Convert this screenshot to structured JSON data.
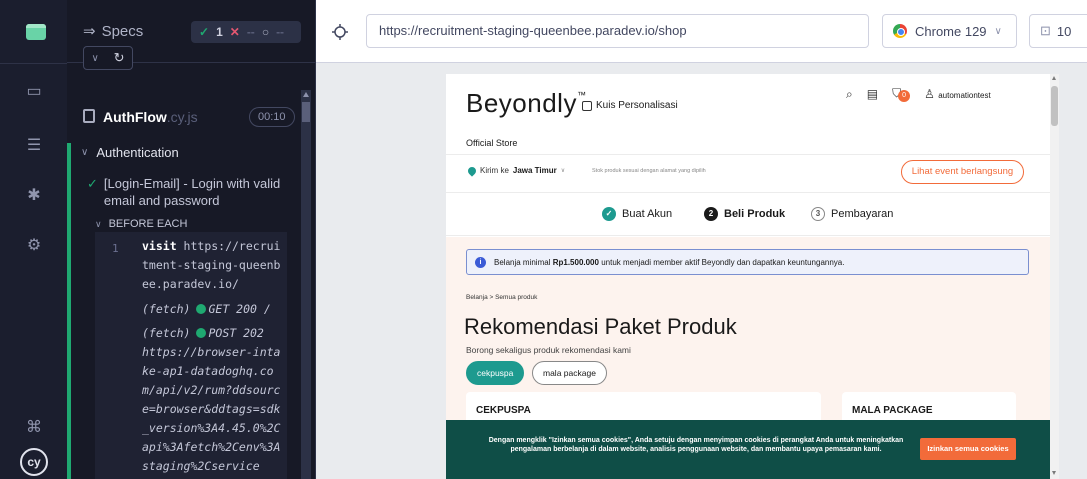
{
  "runner": {
    "specs_label": "Specs",
    "stats": {
      "passed": "1",
      "failed": "--",
      "pending": "--"
    },
    "file": {
      "name": "AuthFlow",
      "ext": ".cy.js",
      "duration": "00:10"
    },
    "suite": "Authentication",
    "test": "[Login-Email] - Login with valid email and password",
    "hook": "BEFORE EACH",
    "command_number": "1",
    "command_visit_kw": "visit",
    "command_visit_url": " https://recruitment-staging-queenbee.paradev.io/",
    "fetch1_label": "(fetch)",
    "fetch1_text": "GET 200 /",
    "fetch2_label": "(fetch)",
    "fetch2_method": "POST 202",
    "fetch2_url": "https://browser-intake-ap1-datadoghq.com/api/v2/rum?ddsource=browser&ddtags=sdk_version%3A4.45.0%2Capi%3Afetch%2Cenv%3Astaging%2Cservice"
  },
  "urlbar": {
    "url": "https://recruitment-staging-queenbee.paradev.io/shop",
    "browser": "Chrome 129",
    "viewport": "10"
  },
  "aut": {
    "brand": "Beyondly",
    "brand_tm": "™",
    "kuis": "Kuis Personalisasi",
    "cart_count": "0",
    "username": "automationtest",
    "official_store": "Official Store",
    "kirim_prefix": "Kirim ke",
    "kirim_location": "Jawa Timur",
    "stok_note": "Stok produk sesuai dengan alamat yang dipilih",
    "event_button": "Lihat event berlangsung",
    "steps": [
      {
        "num": "✓",
        "label": "Buat Akun"
      },
      {
        "num": "2",
        "label": "Beli Produk"
      },
      {
        "num": "3",
        "label": "Pembayaran"
      }
    ],
    "notice_pre": "Belanja minimal ",
    "notice_amount": "Rp1.500.000",
    "notice_post": " untuk menjadi member aktif Beyondly dan dapatkan keuntungannya.",
    "breadcrumb": "Belanja > Semua produk",
    "heading": "Rekomendasi Paket Produk",
    "subheading": "Borong sekaligus produk rekomendasi kami",
    "pills": [
      "cekpuspa",
      "mala package"
    ],
    "cards": [
      "CEKPUSPA",
      "MALA PACKAGE"
    ],
    "cookie_text": "Dengan mengklik \"Izinkan semua cookies\", Anda setuju dengan menyimpan cookies di perangkat Anda untuk meningkatkan pengalaman berbelanja di dalam website, analisis penggunaan website, dan membantu upaya pemasaran kami.",
    "cookie_button": "Izinkan semua cookies"
  },
  "colors": {
    "nav_bg": "#1b1e2e",
    "pass": "#1fa971",
    "fail": "#e45770",
    "teal": "#1d9a8f",
    "orange": "#f26b3a",
    "cookie_bg": "#0f4e47"
  }
}
